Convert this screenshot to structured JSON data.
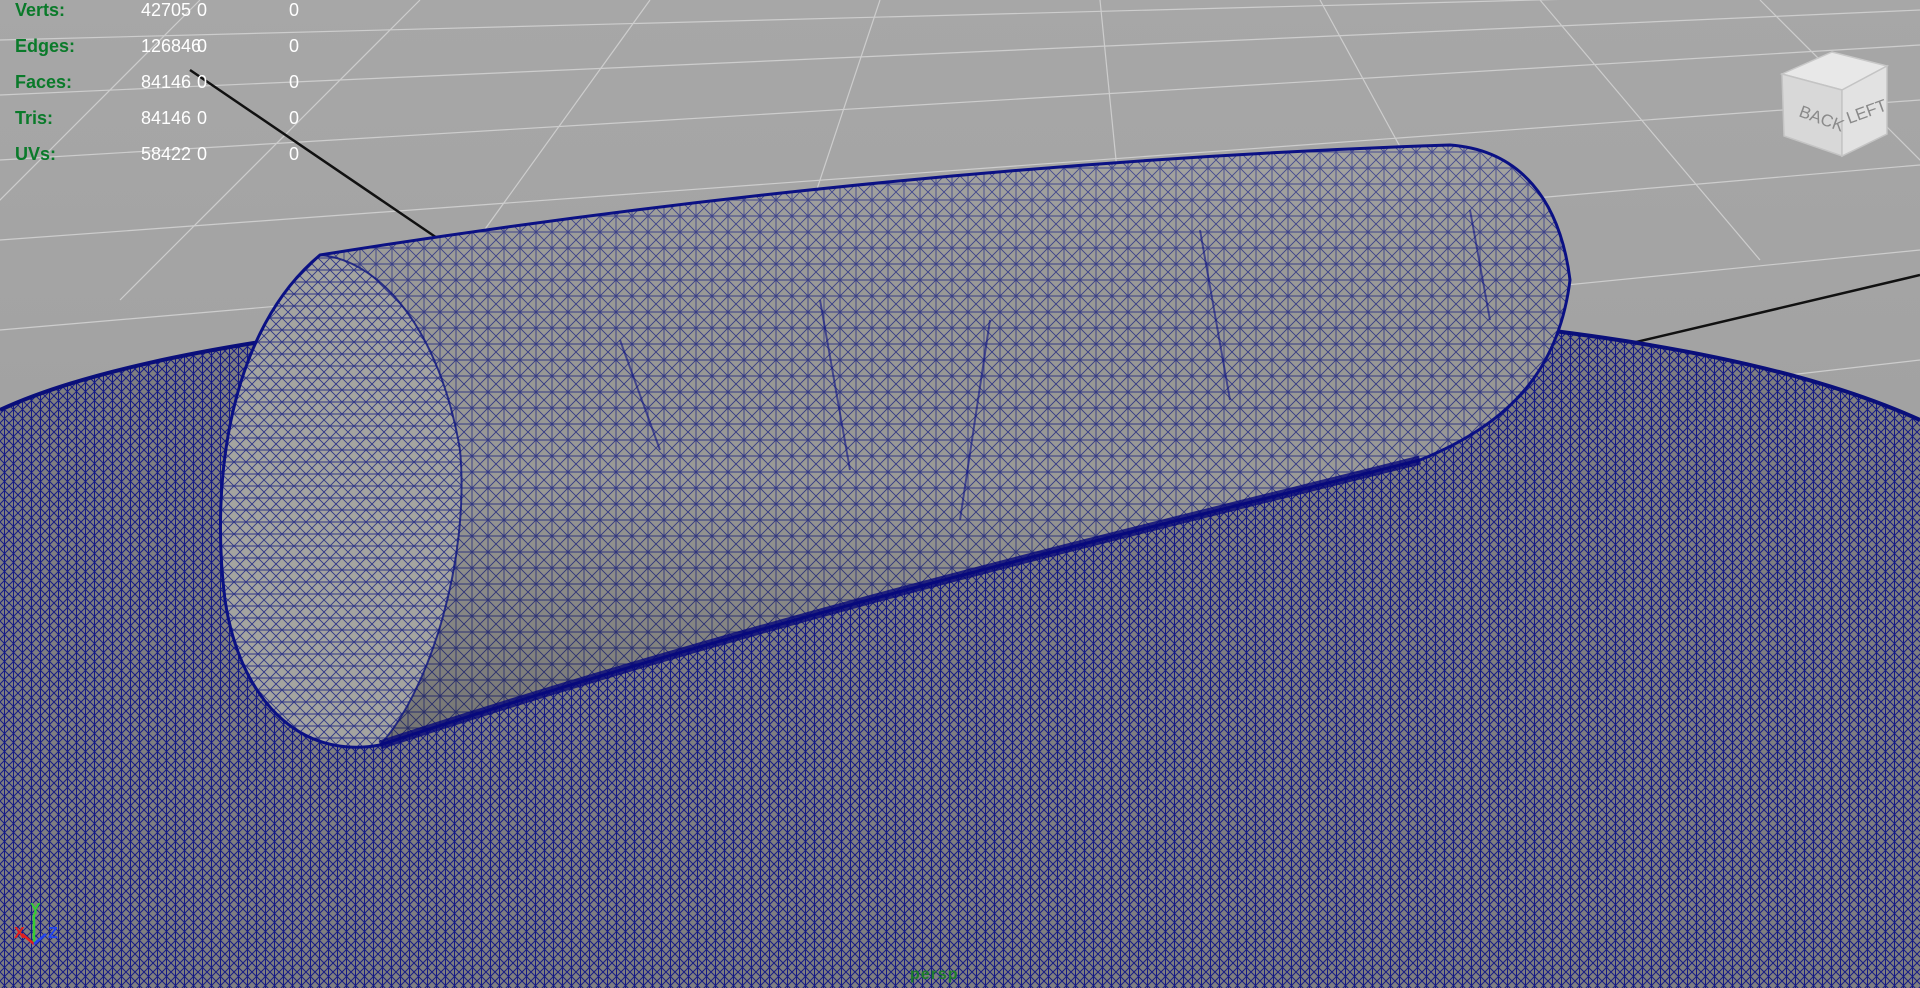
{
  "hud": {
    "rows": [
      {
        "label": "Verts:",
        "value": "42705",
        "c2": "0",
        "c3": "0"
      },
      {
        "label": "Edges:",
        "value": "126846",
        "c2": "0",
        "c3": "0"
      },
      {
        "label": "Faces:",
        "value": "84146",
        "c2": "0",
        "c3": "0"
      },
      {
        "label": "Tris:",
        "value": "84146",
        "c2": "0",
        "c3": "0"
      },
      {
        "label": "UVs:",
        "value": "58422",
        "c2": "0",
        "c3": "0"
      }
    ]
  },
  "view_cube": {
    "face_left": "LEFT",
    "face_back": "BACK"
  },
  "axis": {
    "x": "X",
    "y": "Y",
    "z": "Z"
  },
  "camera": {
    "label": "persp"
  },
  "colors": {
    "wire": "#0c1480",
    "mesh_fill": "#8f8f8c",
    "grid_line": "#cfcfcf",
    "hud_label": "#0a7a2a",
    "hud_value": "#ffffff"
  }
}
